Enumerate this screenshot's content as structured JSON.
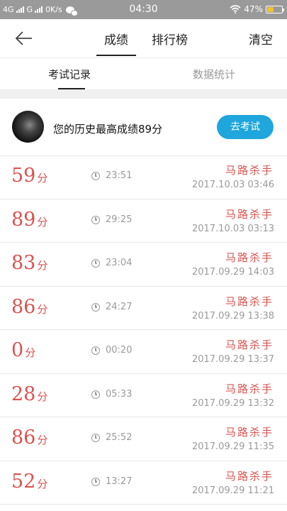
{
  "status_bar": {
    "network": "4G",
    "network2": "G",
    "speed": "0K/s",
    "time": "04:30",
    "battery": "47%"
  },
  "header": {
    "tabs": [
      {
        "label": "成绩",
        "active": true
      },
      {
        "label": "排行榜",
        "active": false
      }
    ],
    "clear_label": "清空"
  },
  "subtabs": [
    {
      "label": "考试记录",
      "active": true
    },
    {
      "label": "数据统计",
      "active": false
    }
  ],
  "profile": {
    "best_text": "您的历史最高成绩89分",
    "exam_button": "去考试"
  },
  "records": [
    {
      "score": "59",
      "unit": "分",
      "duration": "23:51",
      "name": "马路杀手",
      "date": "2017.10.03 03:46"
    },
    {
      "score": "89",
      "unit": "分",
      "duration": "29:25",
      "name": "马路杀手",
      "date": "2017.10.03 03:13"
    },
    {
      "score": "83",
      "unit": "分",
      "duration": "23:04",
      "name": "马路杀手",
      "date": "2017.09.29 14:03"
    },
    {
      "score": "86",
      "unit": "分",
      "duration": "24:27",
      "name": "马路杀手",
      "date": "2017.09.29 13:38"
    },
    {
      "score": "0",
      "unit": "分",
      "duration": "00:20",
      "name": "马路杀手",
      "date": "2017.09.29 13:37"
    },
    {
      "score": "28",
      "unit": "分",
      "duration": "05:33",
      "name": "马路杀手",
      "date": "2017.09.29 13:32"
    },
    {
      "score": "86",
      "unit": "分",
      "duration": "25:52",
      "name": "马路杀手",
      "date": "2017.09.29 11:35"
    },
    {
      "score": "52",
      "unit": "分",
      "duration": "13:27",
      "name": "马路杀手",
      "date": "2017.09.29 11:21"
    }
  ],
  "colors": {
    "accent": "#1fa6dc",
    "score_red": "#d9534f",
    "status_bar": "#9a9a9a"
  }
}
